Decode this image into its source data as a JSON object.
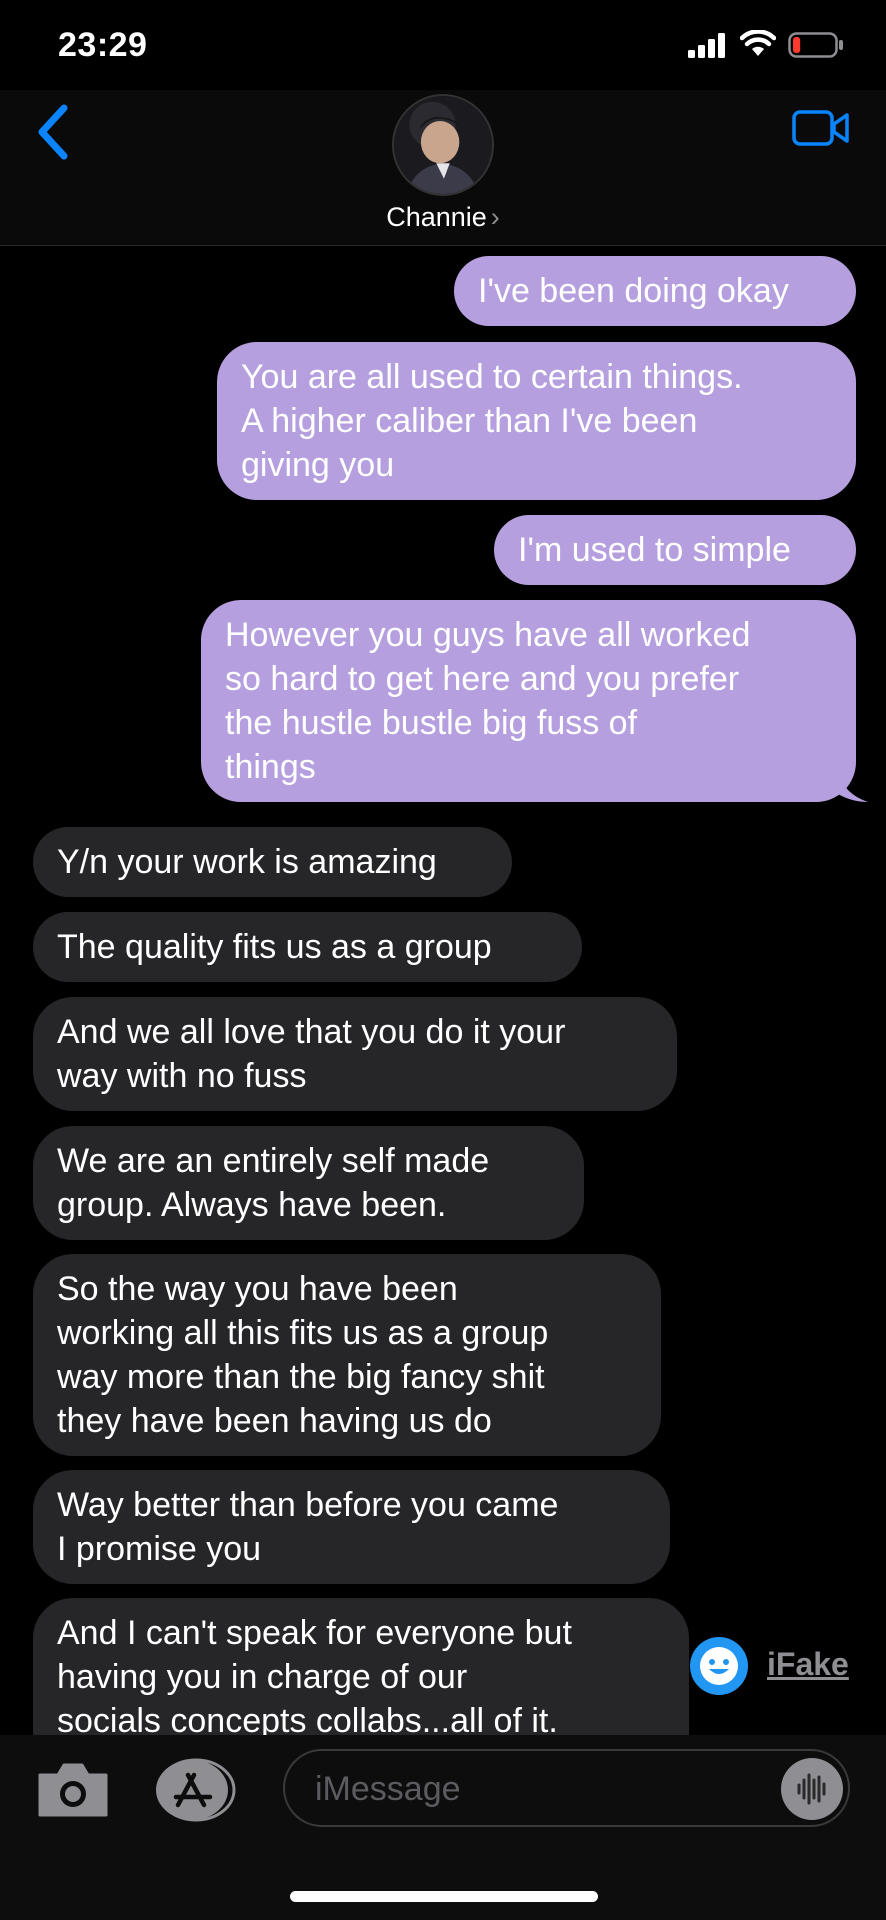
{
  "status_bar": {
    "time": "23:29",
    "battery_level_fraction": 0.15
  },
  "header": {
    "contact_name": "Channie",
    "chevron": "›",
    "icons": {
      "back": "chevron-left-icon",
      "video": "video-camera-icon"
    }
  },
  "colors": {
    "sent_bubble": "#b69fdf",
    "received_bubble": "#262629",
    "accent": "#0a84ff"
  },
  "messages": [
    {
      "direction": "sent",
      "lines": [
        "I've been doing okay"
      ]
    },
    {
      "direction": "sent",
      "lines": [
        "You are all used to certain things.",
        "A higher caliber than I've been",
        "giving you"
      ]
    },
    {
      "direction": "sent",
      "lines": [
        "I'm used to simple"
      ]
    },
    {
      "direction": "sent",
      "lines": [
        "However you guys have all worked",
        "so hard to get here and you prefer",
        "the hustle bustle big fuss of",
        "things"
      ]
    },
    {
      "direction": "received",
      "lines": [
        "Y/n your work is amazing"
      ]
    },
    {
      "direction": "received",
      "lines": [
        "The quality fits us as a group"
      ]
    },
    {
      "direction": "received",
      "lines": [
        "And we all love that you do it your",
        "way with no fuss"
      ]
    },
    {
      "direction": "received",
      "lines": [
        "We are an entirely self made",
        "group. Always have been."
      ]
    },
    {
      "direction": "received",
      "lines": [
        "So the way you have been",
        "working all this fits us as a group",
        "way more than the big fancy shit",
        "they have been having us do"
      ]
    },
    {
      "direction": "received",
      "lines": [
        "Way better than before you came",
        "I promise you"
      ]
    },
    {
      "direction": "received",
      "lines": [
        "And I can't speak for everyone but",
        "having you in charge of our",
        "socials concepts collabs...all of it."
      ]
    }
  ],
  "watermark": {
    "text": "iFake"
  },
  "input_bar": {
    "placeholder": "iMessage"
  }
}
